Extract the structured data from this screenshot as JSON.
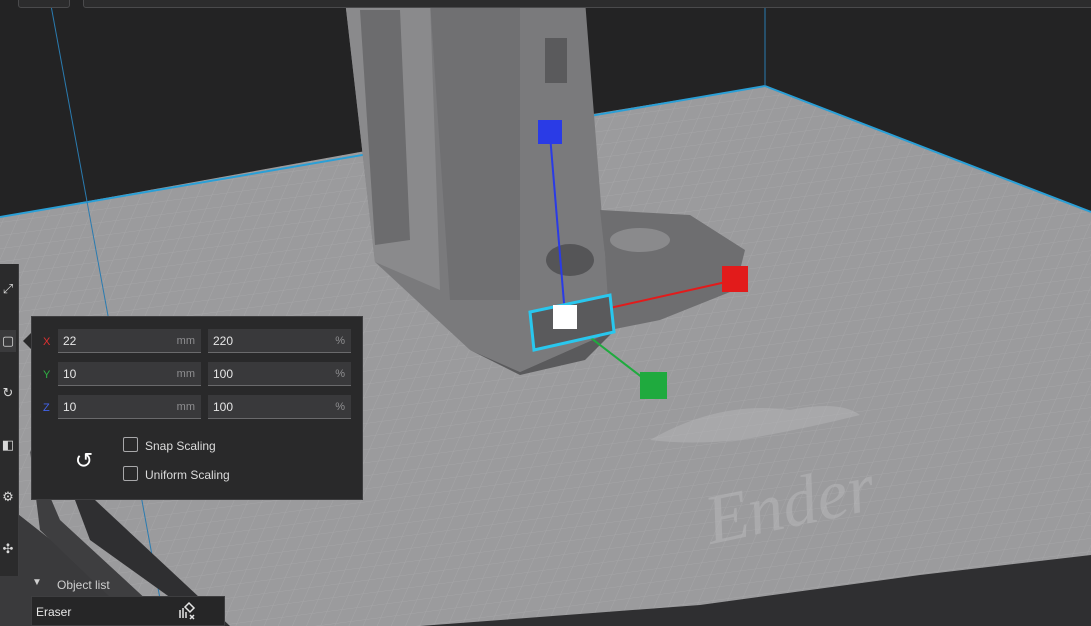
{
  "scale_panel": {
    "rows": [
      {
        "axis": "X",
        "axis_color": "#e03131",
        "mm": "22",
        "mm_unit": "mm",
        "pct": "220",
        "pct_unit": "%"
      },
      {
        "axis": "Y",
        "axis_color": "#2fb344",
        "mm": "10",
        "mm_unit": "mm",
        "pct": "100",
        "pct_unit": "%"
      },
      {
        "axis": "Z",
        "axis_color": "#4263eb",
        "mm": "10",
        "mm_unit": "mm",
        "pct": "100",
        "pct_unit": "%"
      }
    ],
    "snap_scaling": {
      "label": "Snap Scaling",
      "checked": false
    },
    "uniform_scaling": {
      "label": "Uniform Scaling",
      "checked": false
    },
    "reset_icon": "reset-rotate-icon"
  },
  "object_list": {
    "title": "Object list",
    "items": [
      {
        "name": "Eraser",
        "icon": "support-blocker-icon"
      }
    ]
  },
  "viewport": {
    "bed_logo_text": "Ender",
    "gizmo_colors": {
      "x": "#e21b1b",
      "y": "#1faa3e",
      "z": "#2a3be6",
      "selection": "#29c7ee"
    }
  }
}
